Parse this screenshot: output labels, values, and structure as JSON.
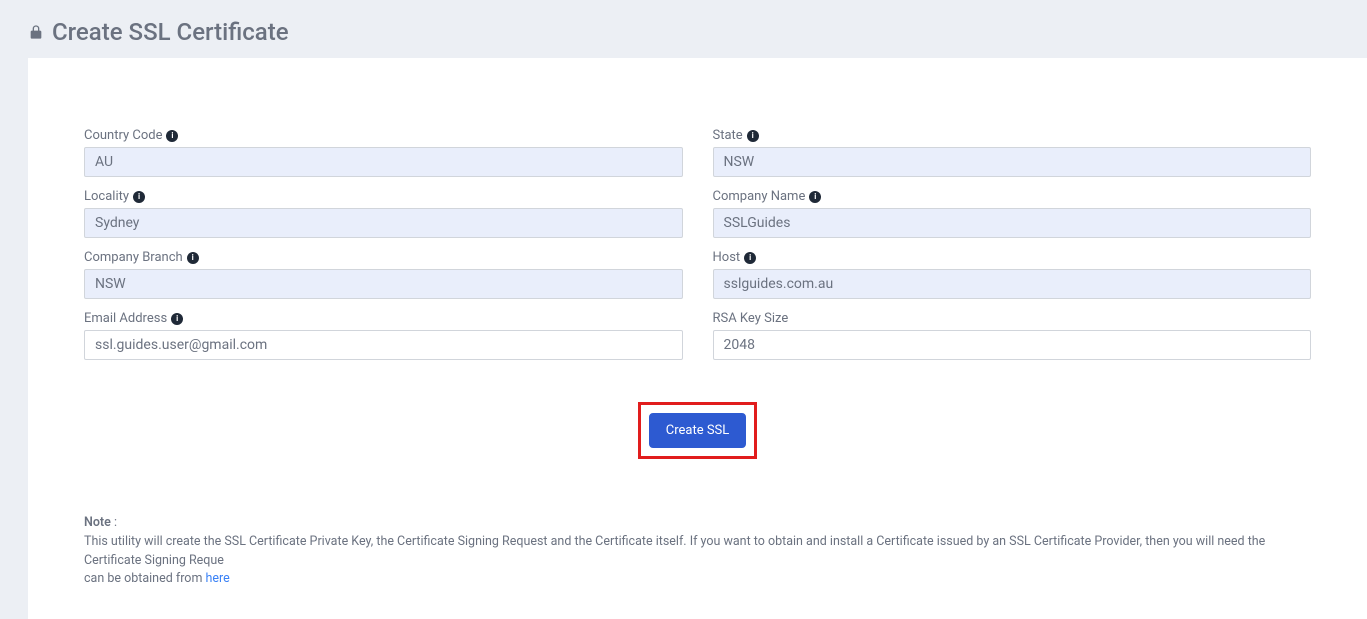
{
  "page": {
    "title": "Create SSL Certificate"
  },
  "form": {
    "country_code": {
      "label": "Country Code",
      "value": "AU",
      "info": true
    },
    "state": {
      "label": "State",
      "value": "NSW",
      "info": true
    },
    "locality": {
      "label": "Locality",
      "value": "Sydney",
      "info": true
    },
    "company_name": {
      "label": "Company Name",
      "value": "SSLGuides",
      "info": true
    },
    "company_branch": {
      "label": "Company Branch",
      "value": "NSW",
      "info": true
    },
    "host": {
      "label": "Host",
      "value": "sslguides.com.au",
      "info": true
    },
    "email": {
      "label": "Email Address",
      "value": "ssl.guides.user@gmail.com",
      "info": true
    },
    "rsa_key_size": {
      "label": "RSA Key Size",
      "value": "2048",
      "info": false
    }
  },
  "button": {
    "create_ssl": "Create SSL"
  },
  "note": {
    "title": "Note",
    "body": "This utility will create the SSL Certificate Private Key, the Certificate Signing Request and the Certificate itself. If you want to obtain and install a Certificate issued by an SSL Certificate Provider, then you will need the Certificate Signing Reque",
    "body2_prefix": "can be obtained from ",
    "link_text": "here"
  }
}
